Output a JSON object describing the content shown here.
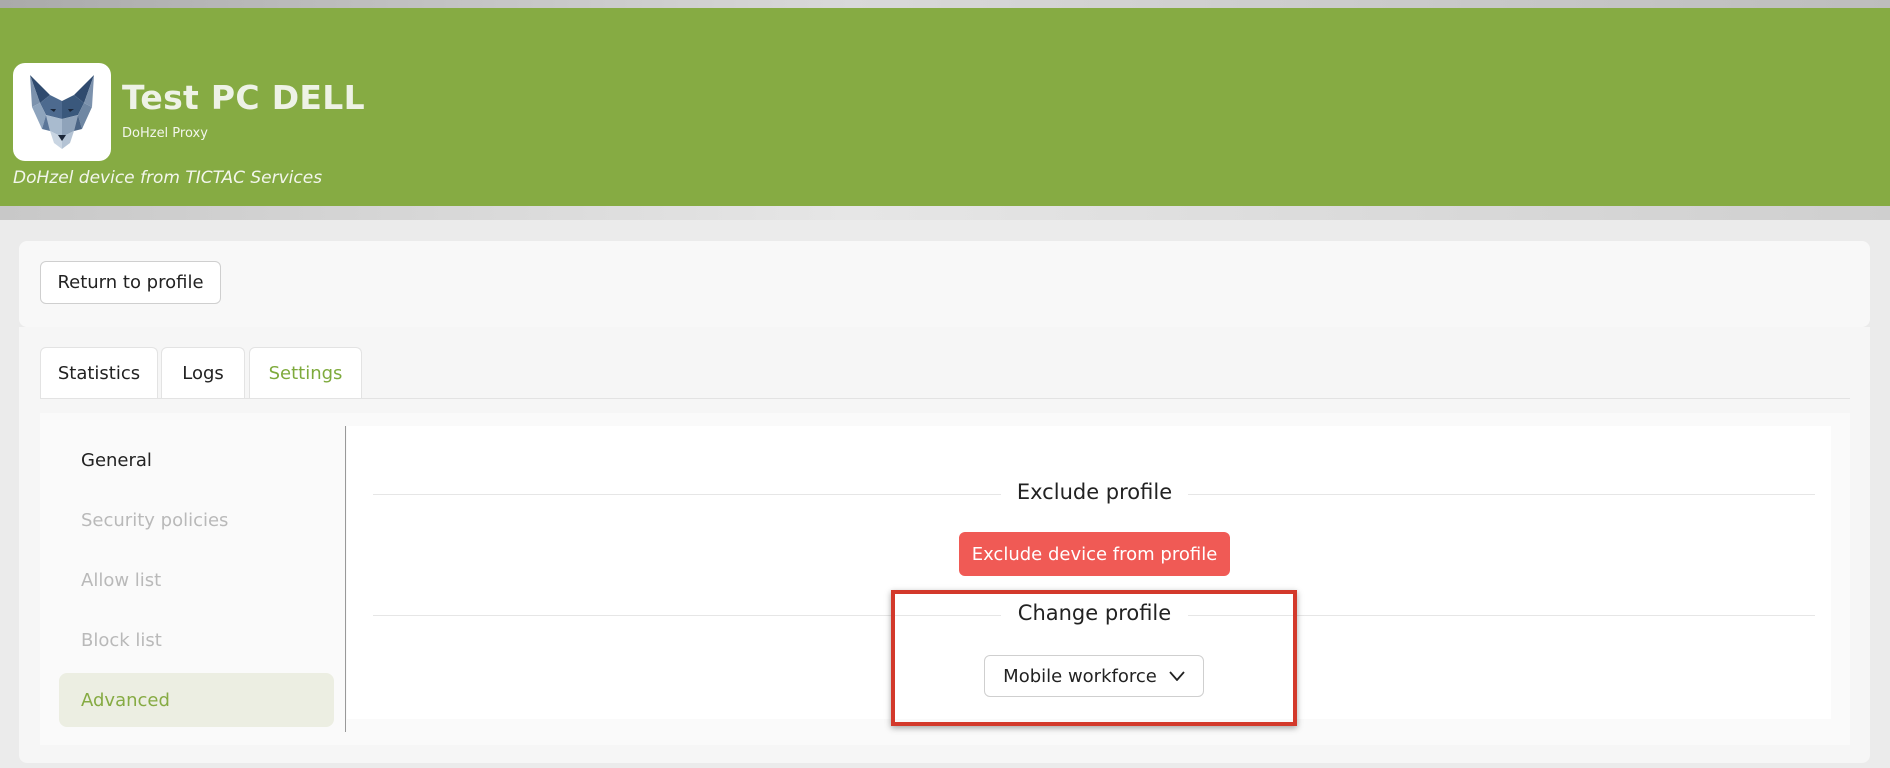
{
  "header": {
    "title": "Test PC DELL",
    "subtitle": "DoHzel Proxy",
    "description": "DoHzel device from TICTAC Services",
    "logo_icon": "wolf-logo-icon",
    "background_color": "#86ab43"
  },
  "toolbar": {
    "return_label": "Return to profile"
  },
  "tabs": [
    {
      "label": "Statistics",
      "active": false
    },
    {
      "label": "Logs",
      "active": false
    },
    {
      "label": "Settings",
      "active": true
    }
  ],
  "sidebar": {
    "items": [
      {
        "label": "General",
        "state": "normal"
      },
      {
        "label": "Security policies",
        "state": "disabled"
      },
      {
        "label": "Allow list",
        "state": "disabled"
      },
      {
        "label": "Block list",
        "state": "disabled"
      },
      {
        "label": "Advanced",
        "state": "active"
      }
    ]
  },
  "exclude_section": {
    "title": "Exclude profile",
    "button_label": "Exclude device from profile",
    "button_color": "#f05a55"
  },
  "change_section": {
    "title": "Change profile",
    "selected_value": "Mobile workforce",
    "dropdown_icon": "chevron-down-icon"
  },
  "annotation": {
    "highlight_color": "#d3392b"
  }
}
